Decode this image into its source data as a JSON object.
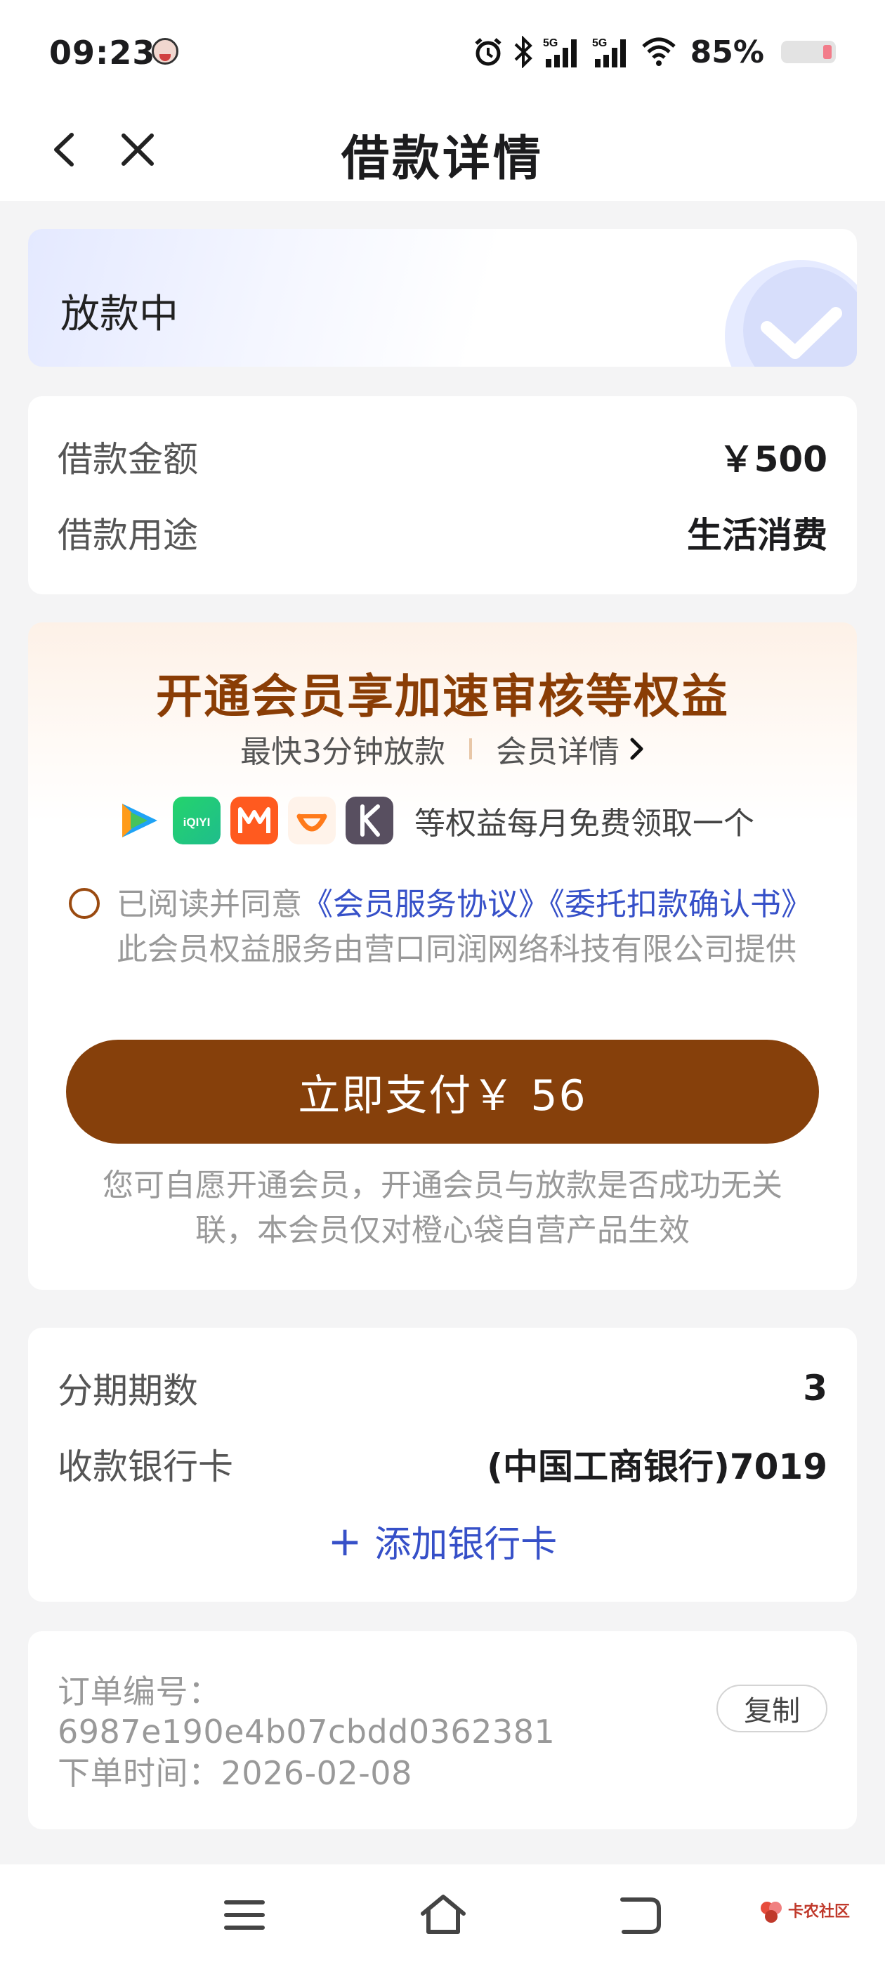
{
  "status_bar": {
    "time": "09:23",
    "network_1": "5G",
    "network_2": "5G",
    "battery_percent": "85%",
    "icons": [
      "alarm-icon",
      "bluetooth-icon",
      "signal-5g-icon",
      "signal-5g-icon",
      "wifi-icon",
      "battery-icon"
    ]
  },
  "nav": {
    "title": "借款详情",
    "back_icon": "chevron-left-icon",
    "close_icon": "close-icon"
  },
  "loan_status": {
    "text": "放款中",
    "icon": "check-circle-icon"
  },
  "loan_info": {
    "amount_label": "借款金额",
    "amount_value": "￥500",
    "purpose_label": "借款用途",
    "purpose_value": "生活消费"
  },
  "membership": {
    "title": "开通会员享加速审核等权益",
    "subtitle": "最快3分钟放款",
    "detail_link": "会员详情",
    "apps": [
      "tencent-video-icon",
      "iqiyi-icon",
      "mango-tv-icon",
      "didi-icon",
      "keep-icon"
    ],
    "apps_text": "等权益每月免费领取一个",
    "agree_prefix": "已阅读并同意",
    "agreement_1": "《会员服务协议》",
    "agreement_2": "《委托扣款确认书》",
    "agree_suffix": "此会员权益服务由营口同润网络科技有限公司提供",
    "pay_button": "立即支付￥ 56",
    "note": "您可自愿开通会员，开通会员与放款是否成功无关联，本会员仅对橙心袋自营产品生效",
    "colors": {
      "brand_brown": "#86400b",
      "link_blue": "#3650c8"
    }
  },
  "repayment": {
    "installments_label": "分期期数",
    "installments_value": "3",
    "bank_label": "收款银行卡",
    "bank_value": "(中国工商银行)7019",
    "add_card": "添加银行卡"
  },
  "order": {
    "number_label": "订单编号：",
    "number_value": "6987e190e4b07cbdd0362381",
    "copy_button": "复制",
    "time_label": "下单时间：",
    "time_value": "2026-02-08"
  },
  "watermark": {
    "text": "卡农社区"
  }
}
